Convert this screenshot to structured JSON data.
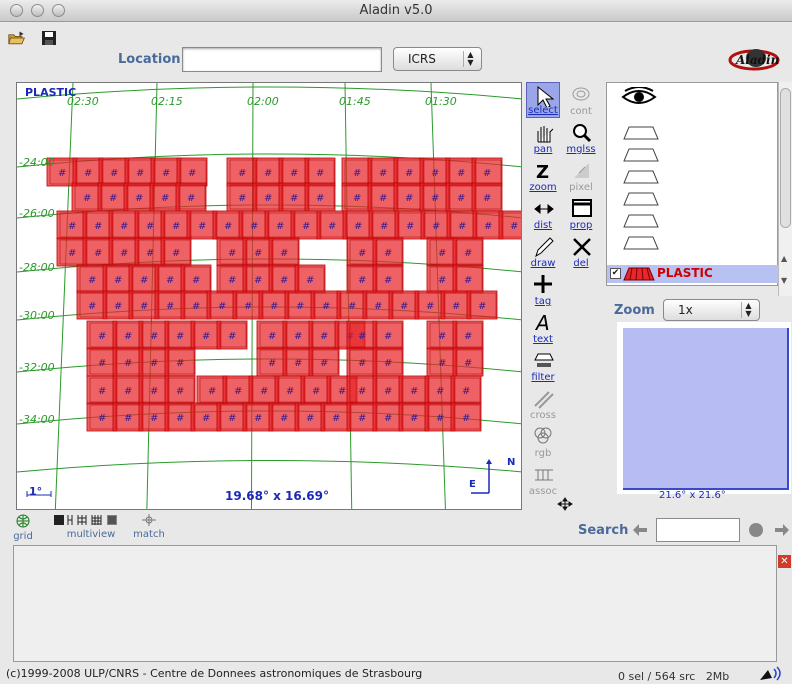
{
  "window": {
    "title": "Aladin v5.0"
  },
  "toolbar": {
    "location_label": "Location",
    "location_value": "",
    "frame_value": "ICRS",
    "logo_text": "Aladin"
  },
  "viewer": {
    "plane_label": "PLASTIC",
    "ra_ticks": [
      "02:30",
      "02:15",
      "02:00",
      "01:45",
      "01:30"
    ],
    "dec_ticks": [
      "-24:00",
      "-26:00",
      "-28:00",
      "-30:00",
      "-32:00",
      "-34:00"
    ],
    "scale_label": "1°",
    "fov_label": "19.68° x 16.69°",
    "compass": {
      "north": "N",
      "east": "E"
    }
  },
  "tools": [
    {
      "label": "select",
      "icon": "arrow-icon",
      "active": true
    },
    {
      "label": "cont",
      "icon": "contour-icon",
      "active": false
    },
    {
      "label": "pan",
      "icon": "hand-icon",
      "active": false
    },
    {
      "label": "mglss",
      "icon": "magnifier-icon",
      "active": false
    },
    {
      "label": "zoom",
      "icon": "zoom-icon",
      "active": false
    },
    {
      "label": "pixel",
      "icon": "pixel-icon",
      "active": false
    },
    {
      "label": "dist",
      "icon": "distance-icon",
      "active": false
    },
    {
      "label": "prop",
      "icon": "properties-icon",
      "active": false
    },
    {
      "label": "draw",
      "icon": "pencil-icon",
      "active": false
    },
    {
      "label": "del",
      "icon": "delete-icon",
      "active": false
    },
    {
      "label": "tag",
      "icon": "tag-icon",
      "active": false
    },
    {
      "label": "text",
      "icon": "text-icon",
      "active": false
    },
    {
      "label": "filter",
      "icon": "filter-icon",
      "active": false
    },
    {
      "label": "cross",
      "icon": "cross-icon",
      "active": false
    },
    {
      "label": "rgb",
      "icon": "rgb-icon",
      "active": false
    },
    {
      "label": "assoc",
      "icon": "assoc-icon",
      "active": false
    }
  ],
  "stack": {
    "plane_name": "PLASTIC",
    "plane_checked": true
  },
  "zoom": {
    "label": "Zoom",
    "value": "1x",
    "fov": "21.6° x 21.6°"
  },
  "bottom": {
    "grid": "grid",
    "multiview": "multiview",
    "match": "match",
    "search_label": "Search",
    "search_value": ""
  },
  "status": {
    "copyright": "(c)1999-2008 ULP/CNRS - Centre de Donnees astronomiques de Strasbourg",
    "selection": "0 sel / 564 src",
    "memory": "2Mb"
  },
  "colors": {
    "footprint": "#e8262b",
    "grid": "#2a9a2a",
    "accent": "#1a2ab8",
    "selected_plane": "#b7c2f2"
  }
}
